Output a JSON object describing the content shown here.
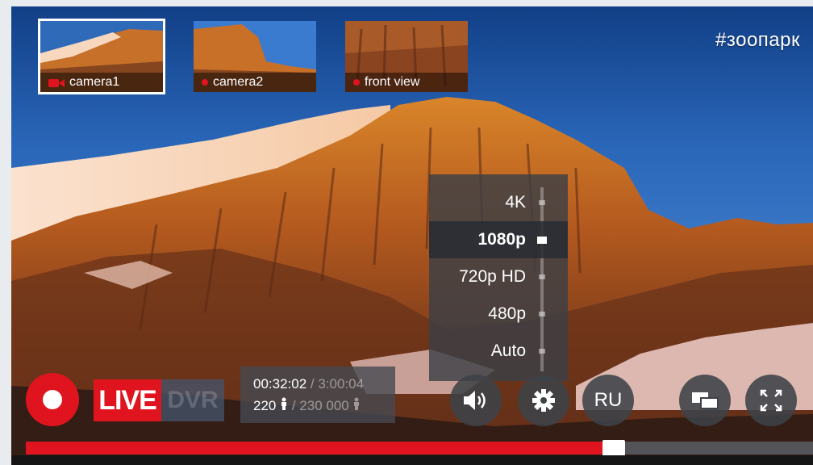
{
  "stream": {
    "hashtag": "#зоопарк",
    "status_label": "LIVE",
    "dvr_label": "DVR",
    "progress_fraction": 0.745
  },
  "cameras": [
    {
      "label": "camera1",
      "active": true,
      "icon": "video-camera-icon"
    },
    {
      "label": "camera2",
      "active": false,
      "icon": "recording-dot-icon"
    },
    {
      "label": "front view",
      "active": false,
      "icon": "recording-dot-icon"
    }
  ],
  "stats": {
    "elapsed": "00:32:02",
    "duration": "/ 3:00:04",
    "viewers": "220",
    "viewers_total": "/ 230 000",
    "viewer_icon": "person-icon"
  },
  "quality_menu": {
    "options": [
      "4K",
      "1080p",
      "720p HD",
      "480p",
      "Auto"
    ],
    "selected": "1080p"
  },
  "controls": {
    "volume_icon": "speaker-icon",
    "settings_icon": "gear-icon",
    "language": "RU",
    "pip_icon": "picture-in-picture-icon",
    "fullscreen_icon": "fullscreen-icon",
    "record_icon": "record-icon"
  },
  "colors": {
    "accent": "#e0141e",
    "panel": "#3e4248"
  }
}
